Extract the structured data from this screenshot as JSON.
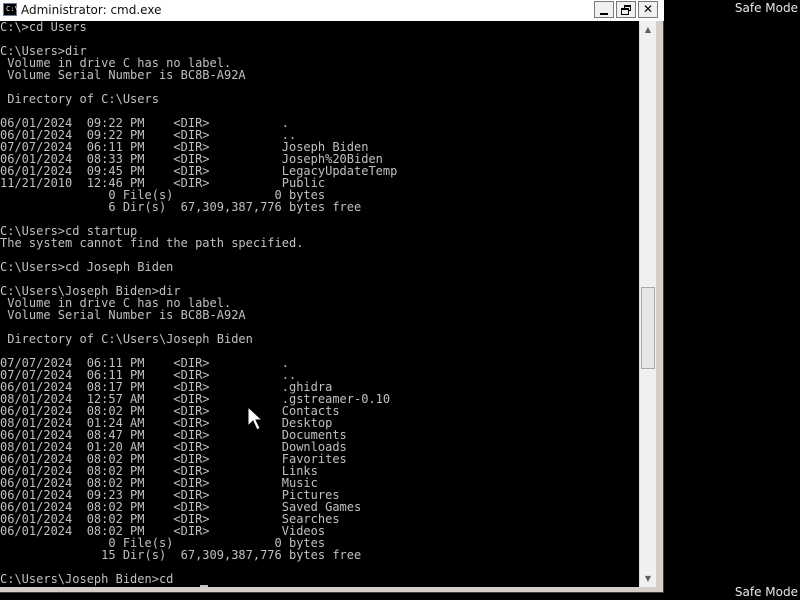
{
  "desktop": {
    "mode_label_top": "Safe Mode",
    "mode_label_bottom": "Safe Mode"
  },
  "window": {
    "title": "Administrator: cmd.exe",
    "icon_text": "C:\\",
    "icon": "console-icon",
    "buttons": {
      "minimize": "minimize-icon",
      "restore": "restore-icon",
      "close": "✕"
    }
  },
  "console": {
    "lines": [
      "C:\\>cd Users",
      "",
      "C:\\Users>dir",
      " Volume in drive C has no label.",
      " Volume Serial Number is BC8B-A92A",
      "",
      " Directory of C:\\Users",
      "",
      "06/01/2024  09:22 PM    <DIR>          .",
      "06/01/2024  09:22 PM    <DIR>          ..",
      "07/07/2024  06:11 PM    <DIR>          Joseph Biden",
      "06/01/2024  08:33 PM    <DIR>          Joseph%20Biden",
      "06/01/2024  09:45 PM    <DIR>          LegacyUpdateTemp",
      "11/21/2010  12:46 PM    <DIR>          Public",
      "               0 File(s)              0 bytes",
      "               6 Dir(s)  67,309,387,776 bytes free",
      "",
      "C:\\Users>cd startup",
      "The system cannot find the path specified.",
      "",
      "C:\\Users>cd Joseph Biden",
      "",
      "C:\\Users\\Joseph Biden>dir",
      " Volume in drive C has no label.",
      " Volume Serial Number is BC8B-A92A",
      "",
      " Directory of C:\\Users\\Joseph Biden",
      "",
      "07/07/2024  06:11 PM    <DIR>          .",
      "07/07/2024  06:11 PM    <DIR>          ..",
      "06/01/2024  08:17 PM    <DIR>          .ghidra",
      "08/01/2024  12:57 AM    <DIR>          .gstreamer-0.10",
      "06/01/2024  08:02 PM    <DIR>          Contacts",
      "08/01/2024  01:24 AM    <DIR>          Desktop",
      "06/01/2024  08:47 PM    <DIR>          Documents",
      "08/01/2024  01:20 AM    <DIR>          Downloads",
      "06/01/2024  08:02 PM    <DIR>          Favorites",
      "06/01/2024  08:02 PM    <DIR>          Links",
      "06/01/2024  08:02 PM    <DIR>          Music",
      "06/01/2024  09:23 PM    <DIR>          Pictures",
      "06/01/2024  08:02 PM    <DIR>          Saved Games",
      "06/01/2024  08:02 PM    <DIR>          Searches",
      "06/01/2024  08:02 PM    <DIR>          Videos",
      "               0 File(s)              0 bytes",
      "              15 Dir(s)  67,309,387,776 bytes free",
      "",
      "C:\\Users\\Joseph Biden>cd "
    ]
  },
  "scrollbar": {
    "up_icon": "▲",
    "down_icon": "▼",
    "position_fraction": 0.47
  },
  "cursor": {
    "icon": "mouse-pointer-icon"
  }
}
